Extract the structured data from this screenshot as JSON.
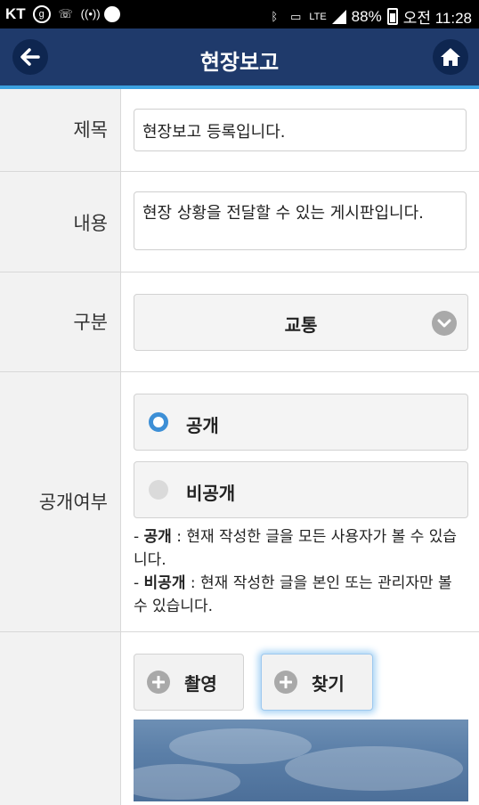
{
  "status_bar": {
    "carrier": "KT",
    "battery": "88%",
    "time": "오전 11:28",
    "network": "LTE"
  },
  "header": {
    "title": "현장보고",
    "back_icon": "arrow-left-icon",
    "home_icon": "home-icon",
    "color": "#1f3a6b",
    "accent": "#3aa0e0"
  },
  "form": {
    "title_label": "제목",
    "title_value": "현장보고 등록입니다.",
    "content_label": "내용",
    "content_value": "현장 상황을 전달할 수 있는 게시판입니다.",
    "category_label": "구분",
    "category_value": "교통",
    "visibility_label": "공개여부",
    "options": [
      {
        "label": "공개",
        "selected": true
      },
      {
        "label": "비공개",
        "selected": false
      }
    ],
    "desc": {
      "public_term": "공개",
      "public_text": " : 현재 작성한 글을 모든 사용자가 볼 수 있습니다.",
      "private_term": "비공개",
      "private_text": " : 현재 작성한 글을 본인 또는 관리자만 볼 수 있습니다."
    },
    "buttons": {
      "capture": "촬영",
      "find": "찾기"
    }
  }
}
